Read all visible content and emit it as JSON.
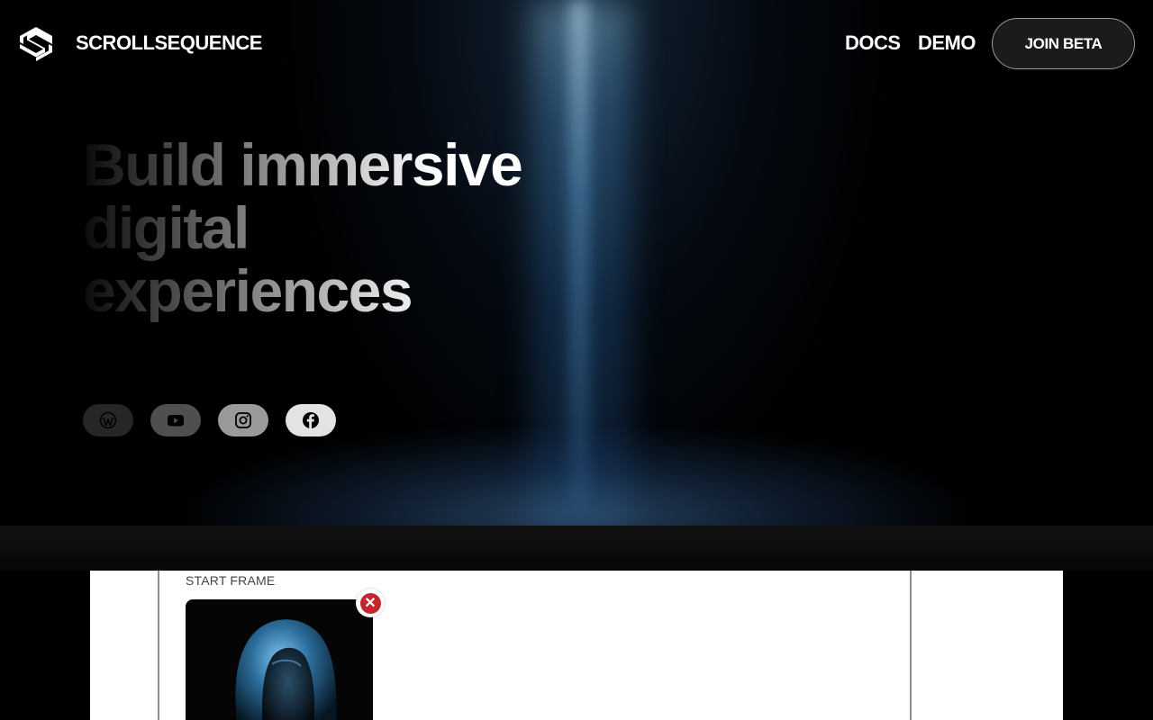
{
  "header": {
    "brand": "SCROLLSEQUENCE",
    "nav": {
      "docs": "DOCS",
      "demo": "DEMO",
      "join_beta": "JOIN BETA"
    }
  },
  "hero": {
    "title_lines": [
      "Build immersive",
      "digital",
      "experiences"
    ]
  },
  "socials": [
    {
      "icon": "wordpress-icon"
    },
    {
      "icon": "youtube-icon"
    },
    {
      "icon": "instagram-icon"
    },
    {
      "icon": "facebook-icon"
    }
  ],
  "preview": {
    "start_frame_label": "START FRAME",
    "remove_glyph": "✕"
  },
  "colors": {
    "background": "#000000",
    "accent_glow": "#3c78b4",
    "remove_red": "#c2272d"
  }
}
